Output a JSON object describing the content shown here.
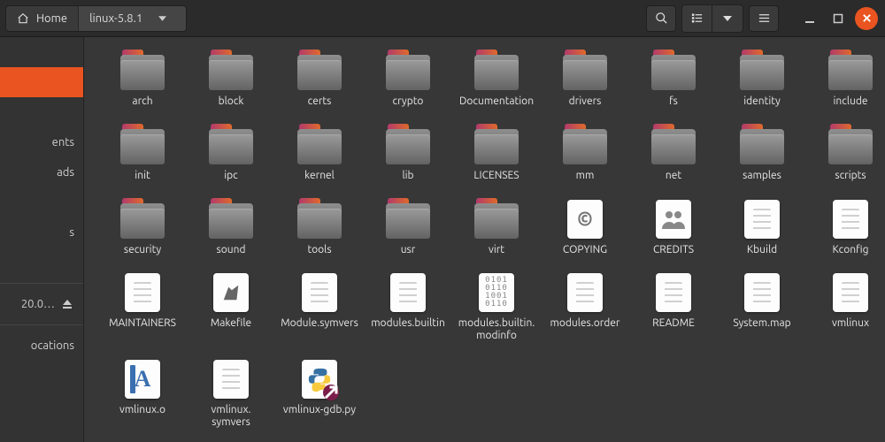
{
  "path": {
    "home": "Home",
    "current": "linux-5.8.1"
  },
  "sidebar": {
    "items": [
      {
        "label": "",
        "kind": "blank"
      },
      {
        "label": "",
        "kind": "selected"
      },
      {
        "label": "",
        "kind": "blank"
      },
      {
        "label": "ents",
        "kind": "text"
      },
      {
        "label": "ads",
        "kind": "text"
      },
      {
        "label": "",
        "kind": "blank"
      },
      {
        "label": "s",
        "kind": "text"
      },
      {
        "label": "",
        "kind": "blank"
      },
      {
        "label": "",
        "kind": "sep"
      },
      {
        "label": "20.0…",
        "kind": "disk"
      },
      {
        "label": "",
        "kind": "sep"
      },
      {
        "label": "ocations",
        "kind": "text"
      }
    ]
  },
  "items": [
    {
      "name": "arch",
      "type": "folder"
    },
    {
      "name": "block",
      "type": "folder"
    },
    {
      "name": "certs",
      "type": "folder"
    },
    {
      "name": "crypto",
      "type": "folder"
    },
    {
      "name": "Documentation",
      "type": "folder"
    },
    {
      "name": "drivers",
      "type": "folder"
    },
    {
      "name": "fs",
      "type": "folder"
    },
    {
      "name": "identity",
      "type": "folder"
    },
    {
      "name": "include",
      "type": "folder"
    },
    {
      "name": "init",
      "type": "folder"
    },
    {
      "name": "ipc",
      "type": "folder"
    },
    {
      "name": "kernel",
      "type": "folder"
    },
    {
      "name": "lib",
      "type": "folder"
    },
    {
      "name": "LICENSES",
      "type": "folder"
    },
    {
      "name": "mm",
      "type": "folder"
    },
    {
      "name": "net",
      "type": "folder"
    },
    {
      "name": "samples",
      "type": "folder"
    },
    {
      "name": "scripts",
      "type": "folder"
    },
    {
      "name": "security",
      "type": "folder"
    },
    {
      "name": "sound",
      "type": "folder"
    },
    {
      "name": "tools",
      "type": "folder"
    },
    {
      "name": "usr",
      "type": "folder"
    },
    {
      "name": "virt",
      "type": "folder"
    },
    {
      "name": "COPYING",
      "type": "copying"
    },
    {
      "name": "CREDITS",
      "type": "credits"
    },
    {
      "name": "Kbuild",
      "type": "text"
    },
    {
      "name": "Kconfig",
      "type": "text"
    },
    {
      "name": "MAINTAINERS",
      "type": "text"
    },
    {
      "name": "Makefile",
      "type": "makefile"
    },
    {
      "name": "Module.symvers",
      "type": "text"
    },
    {
      "name": "modules.builtin",
      "type": "text"
    },
    {
      "name": "modules.builtin.modinfo",
      "type": "binary"
    },
    {
      "name": "modules.order",
      "type": "text"
    },
    {
      "name": "README",
      "type": "text"
    },
    {
      "name": "System.map",
      "type": "text"
    },
    {
      "name": "vmlinux",
      "type": "text"
    },
    {
      "name": "vmlinux.o",
      "type": "obj"
    },
    {
      "name": "vmlinux.symvers",
      "type": "text"
    },
    {
      "name": "vmlinux-gdb.py",
      "type": "python"
    }
  ]
}
